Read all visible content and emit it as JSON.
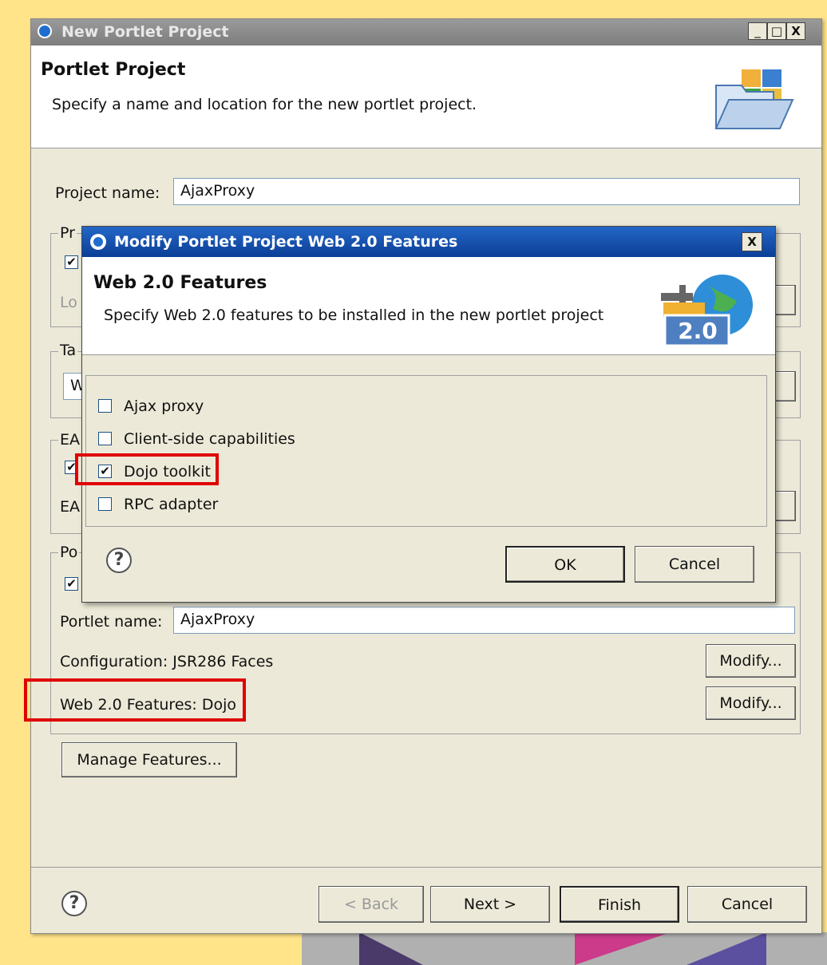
{
  "window": {
    "title": "New Portlet Project",
    "controls": [
      "_",
      "□",
      "X"
    ]
  },
  "header": {
    "title": "Portlet Project",
    "subtitle": "Specify a name and location for the new portlet project."
  },
  "project": {
    "name_label": "Project name:",
    "name_value": "AjaxProxy"
  },
  "partial_groups": {
    "group1_label": "Pr",
    "group1_link": "Lo",
    "group2_label": "Ta",
    "group2_field": "W",
    "group3_label": "EA",
    "group3_sub": "EA",
    "group4_label": "Po"
  },
  "portlet": {
    "name_label": "Portlet name:",
    "name_value": "AjaxProxy",
    "configuration": "Configuration: JSR286 Faces",
    "web20": "Web 2.0 Features: Dojo",
    "modify1": "Modify...",
    "modify2": "Modify...",
    "manage": "Manage Features..."
  },
  "footer": {
    "back": "< Back",
    "next": "Next >",
    "finish": "Finish",
    "cancel": "Cancel"
  },
  "modal": {
    "title": "Modify Portlet Project Web 2.0 Features",
    "close": "X",
    "header_title": "Web 2.0 Features",
    "header_sub": "Specify Web 2.0 features to be installed in the new portlet project",
    "badge": "2.0",
    "features": [
      {
        "label": "Ajax proxy",
        "checked": false
      },
      {
        "label": "Client-side capabilities",
        "checked": false
      },
      {
        "label": "Dojo toolkit",
        "checked": true
      },
      {
        "label": "RPC adapter",
        "checked": false
      }
    ],
    "ok": "OK",
    "cancel": "Cancel"
  },
  "colors": {
    "highlight": "#e00000",
    "modal_title": "#0a3e96",
    "background": "#ffe48a"
  }
}
